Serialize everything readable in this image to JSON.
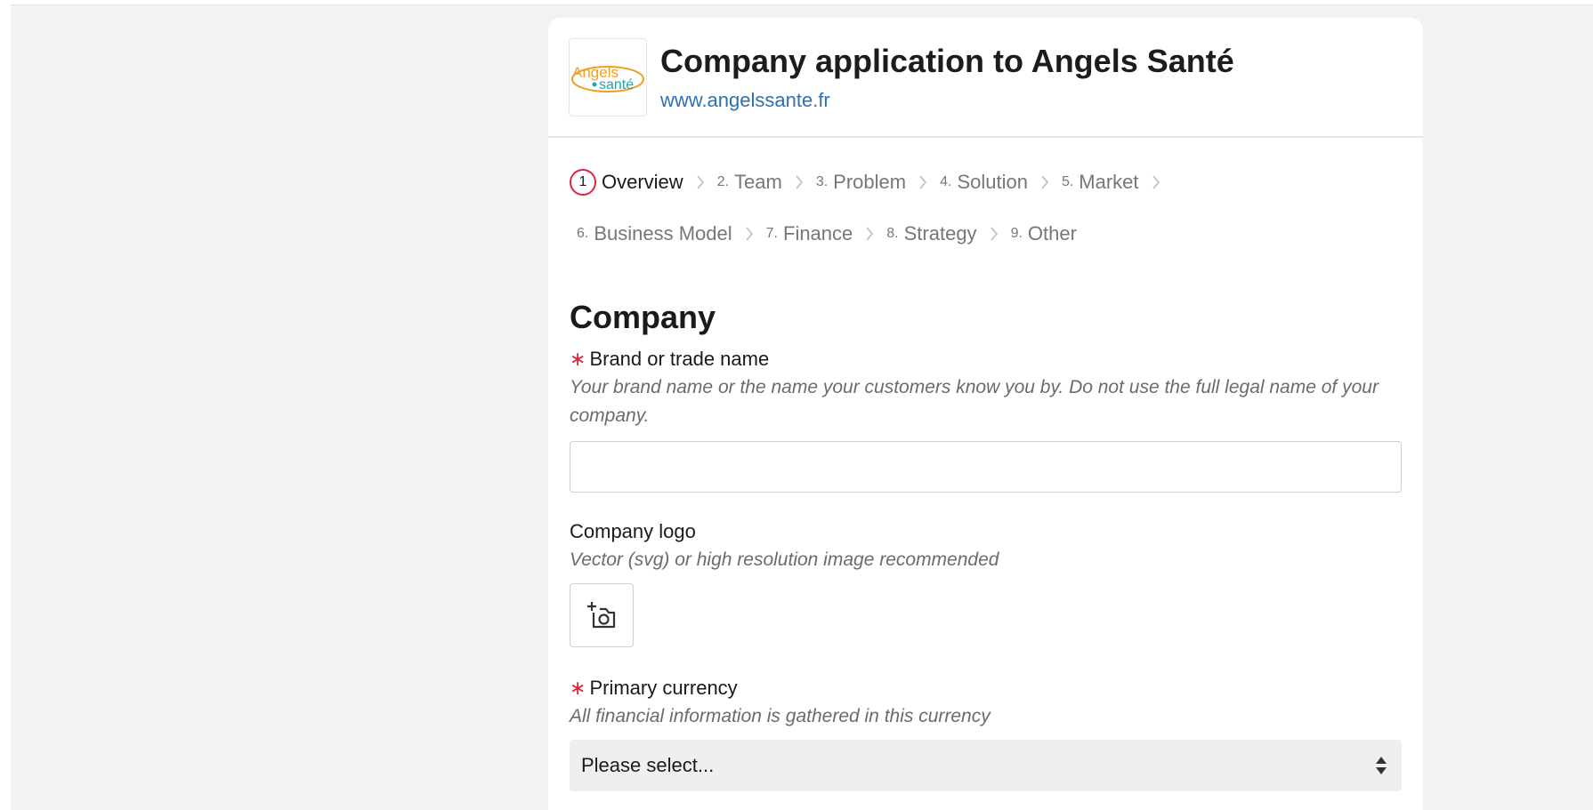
{
  "header": {
    "title": "Company application to Angels Santé",
    "website": "www.angelssante.fr",
    "logo_text_top": "Angels",
    "logo_text_bottom": "santé"
  },
  "steps": [
    {
      "num": "1",
      "label": "Overview",
      "active": true
    },
    {
      "num": "2.",
      "label": "Team"
    },
    {
      "num": "3.",
      "label": "Problem"
    },
    {
      "num": "4.",
      "label": "Solution"
    },
    {
      "num": "5.",
      "label": "Market"
    },
    {
      "num": "6.",
      "label": "Business Model"
    },
    {
      "num": "7.",
      "label": "Finance"
    },
    {
      "num": "8.",
      "label": "Strategy"
    },
    {
      "num": "9.",
      "label": "Other"
    }
  ],
  "form": {
    "section_title": "Company",
    "brand": {
      "required_mark": "∗",
      "label": "Brand or trade name",
      "help": "Your brand name or the name your customers know you by. Do not use the full legal name of your company.",
      "value": ""
    },
    "logo": {
      "label": "Company logo",
      "help": "Vector (svg) or high resolution image recommended"
    },
    "currency": {
      "required_mark": "∗",
      "label": "Primary currency",
      "help": "All financial information is gathered in this currency",
      "selected": "Please select..."
    }
  },
  "colors": {
    "accent_red": "#e0243c",
    "link_blue": "#2f6fb4",
    "logo_orange": "#f0a020",
    "logo_teal": "#1aa6b5"
  },
  "icons": {
    "upload": "add-photo-icon",
    "select": "sort-arrows-icon",
    "separator": "chevron-right-icon"
  }
}
